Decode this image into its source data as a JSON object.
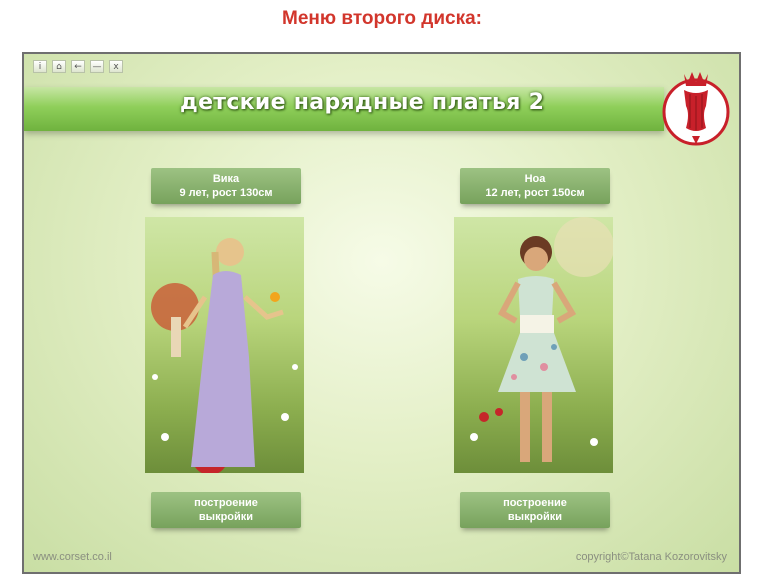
{
  "page": {
    "heading": "Меню второго диска:"
  },
  "toolbar": {
    "buttons": [
      {
        "icon": "info-icon",
        "glyph": "i"
      },
      {
        "icon": "home-icon",
        "glyph": "⌂"
      },
      {
        "icon": "back-arrow-icon",
        "glyph": "←"
      },
      {
        "icon": "minimize-icon",
        "glyph": "—"
      },
      {
        "icon": "close-icon",
        "glyph": "x"
      }
    ]
  },
  "banner": {
    "title": "детские нарядные платья 2"
  },
  "models": [
    {
      "name": "Вика",
      "info": "9 лет, рост 130см",
      "button_line1": "построение",
      "button_line2": "выкройки",
      "dress_color": "#b8a9d9"
    },
    {
      "name": "Ноа",
      "info": "12 лет, рост 150см",
      "button_line1": "построение",
      "button_line2": "выкройки",
      "dress_color": "#cfe3d3"
    }
  ],
  "footer": {
    "left": "www.corset.co.il",
    "right": "copyright©Tatana Kozorovitsky"
  },
  "colors": {
    "heading": "#d2362c",
    "banner": "#8fcf5a",
    "button": "#86ad6a",
    "logo": "#c8202a"
  }
}
